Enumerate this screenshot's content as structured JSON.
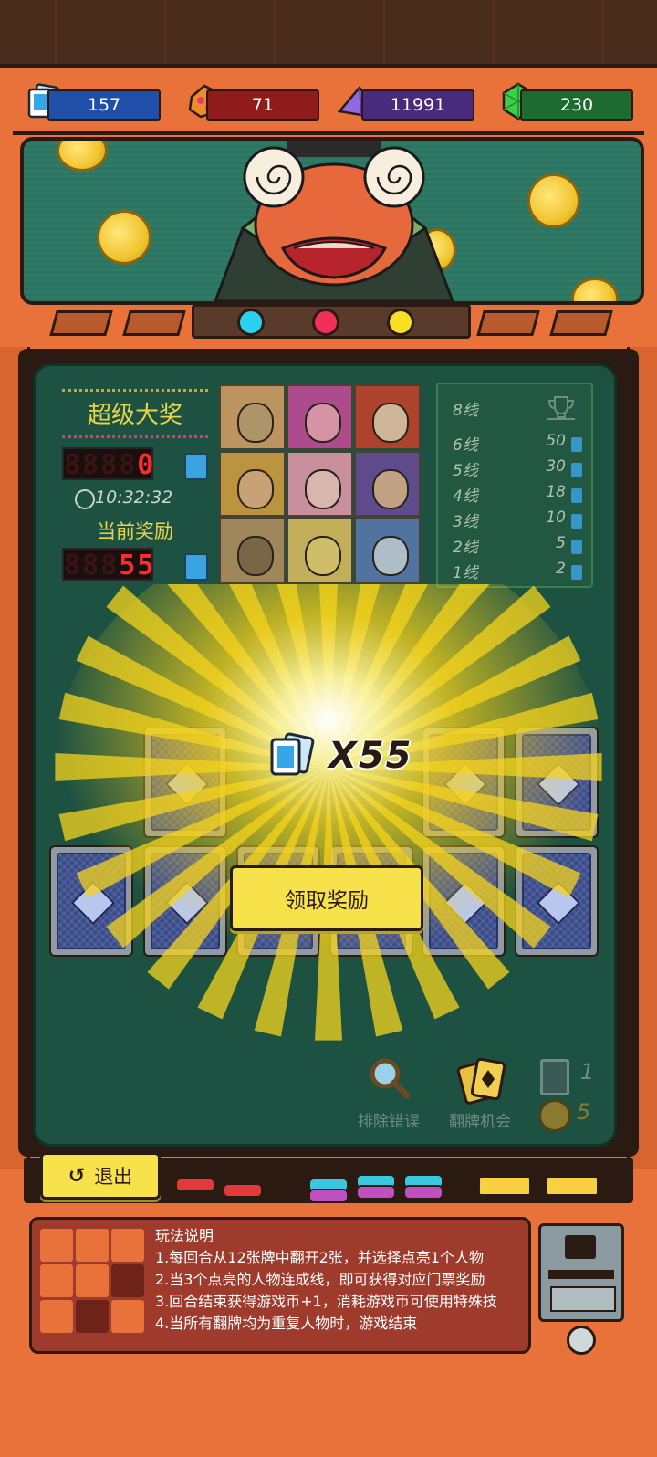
{
  "resources": [
    {
      "name": "tickets",
      "icon": "ticket-icon",
      "value": "157",
      "color": "#1f4fa8"
    },
    {
      "name": "gem",
      "icon": "rainbow-gem-icon",
      "value": "71",
      "color": "#8f1b1b"
    },
    {
      "name": "crystal",
      "icon": "purple-crystal-icon",
      "value": "11991",
      "color": "#4a2a7a"
    },
    {
      "name": "emerald",
      "icon": "green-gem-icon",
      "value": "230",
      "color": "#1d6b2e"
    }
  ],
  "jackpot": {
    "title": "超级大奖",
    "value": "0",
    "ghost": "8888",
    "time": "10:32:32",
    "current_label": "当前奖励",
    "current_value": "55",
    "current_ghost": "888"
  },
  "prize_table": [
    {
      "line": "8线",
      "reward": "",
      "icon": "trophy-icon"
    },
    {
      "line": "6线",
      "reward": "50"
    },
    {
      "line": "5线",
      "reward": "30"
    },
    {
      "line": "4线",
      "reward": "18"
    },
    {
      "line": "3线",
      "reward": "10"
    },
    {
      "line": "2线",
      "reward": "5"
    },
    {
      "line": "1线",
      "reward": "2"
    }
  ],
  "reward_popup": {
    "multiplier": "X55",
    "claim_label": "领取奖励"
  },
  "tools": {
    "remove_error_label": "排除错误",
    "flip_chance_label": "翻牌机会",
    "card_count": "1",
    "coin_count": "5"
  },
  "exit_label": "退出",
  "rules": {
    "title": "玩法说明",
    "lines": [
      "1.每回合从12张牌中翻开2张，并选择点亮1个人物",
      "2.当3个点亮的人物连成线，即可获得对应门票奖励",
      "3.回合结束获得游戏币+1，消耗游戏币可使用特殊技",
      "4.当所有翻牌均为重复人物时，游戏结束"
    ]
  },
  "light_colors": [
    "#2ad0f0",
    "#f0305a",
    "#f8e020"
  ]
}
